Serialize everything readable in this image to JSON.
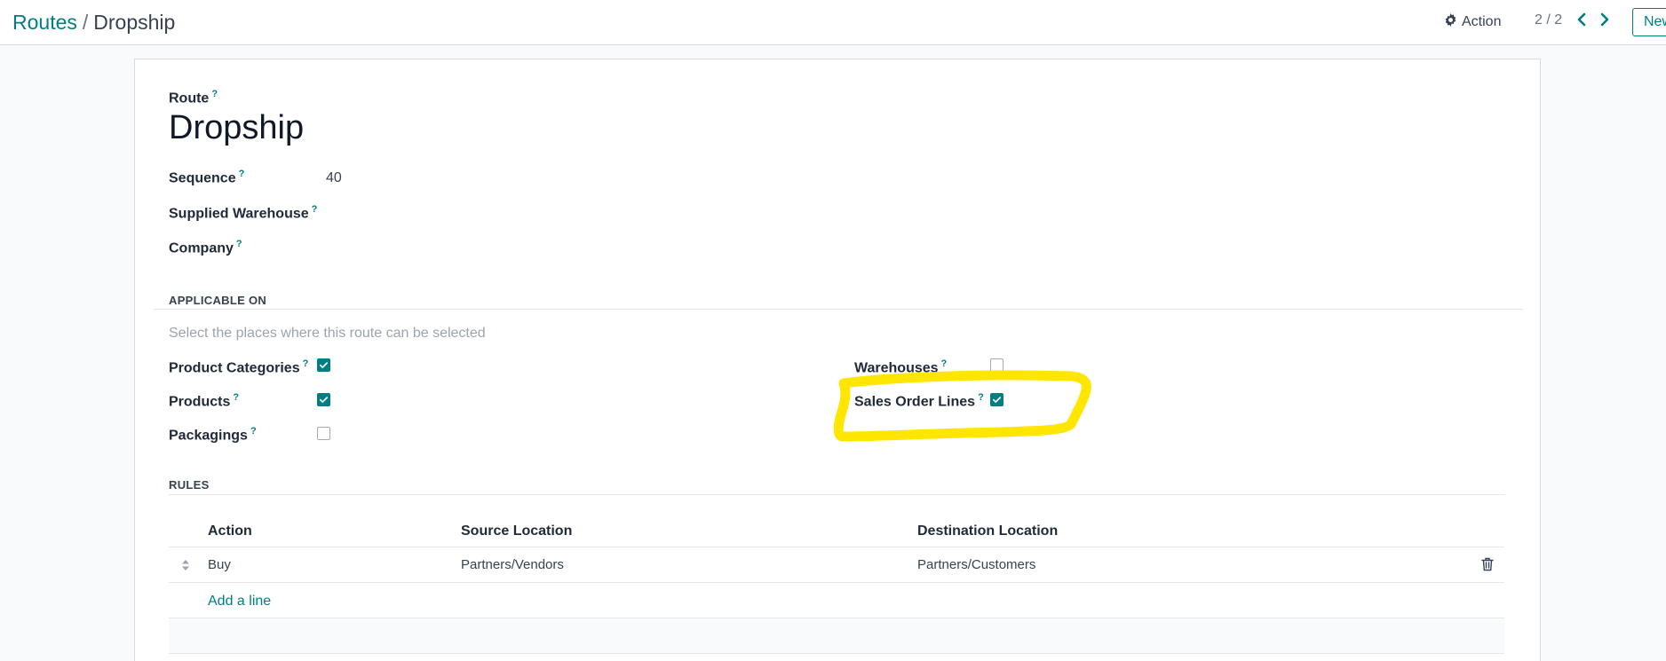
{
  "breadcrumb": {
    "parent": "Routes",
    "separator": "/",
    "current": "Dropship"
  },
  "toolbar": {
    "action_label": "Action",
    "pager_value": "2 / 2",
    "new_label": "New"
  },
  "form": {
    "route_label": "Route",
    "help_mark": "?",
    "route_name": "Dropship",
    "fields": {
      "sequence_label": "Sequence",
      "sequence_value": "40",
      "supplied_warehouse_label": "Supplied Warehouse",
      "company_label": "Company"
    },
    "applicable_on": {
      "title": "APPLICABLE ON",
      "hint": "Select the places where this route can be selected",
      "product_categories_label": "Product Categories",
      "product_categories_checked": true,
      "products_label": "Products",
      "products_checked": true,
      "packagings_label": "Packagings",
      "packagings_checked": false,
      "warehouses_label": "Warehouses",
      "warehouses_checked": false,
      "sales_order_lines_label": "Sales Order Lines",
      "sales_order_lines_checked": true
    },
    "rules": {
      "title": "RULES",
      "columns": [
        "Action",
        "Source Location",
        "Destination Location"
      ],
      "rows": [
        {
          "action": "Buy",
          "source": "Partners/Vendors",
          "destination": "Partners/Customers"
        }
      ],
      "add_line_label": "Add a line"
    }
  },
  "colors": {
    "accent": "#017e84",
    "highlight": "#ffe600"
  },
  "icons": {
    "action": "gear-icon",
    "pager_prev": "chevron-left-icon",
    "pager_next": "chevron-right-icon",
    "checkbox_checked": "check-icon",
    "row_handle": "drag-handle-icon",
    "row_delete": "trash-icon"
  }
}
